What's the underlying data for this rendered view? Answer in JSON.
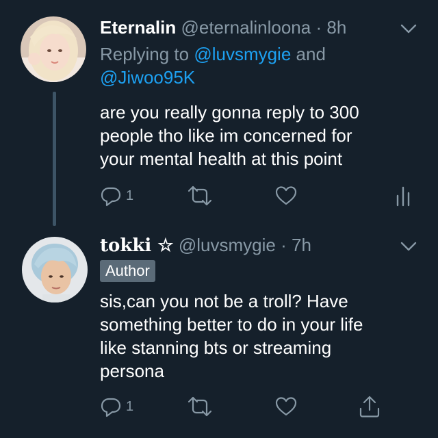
{
  "tweets": [
    {
      "display_name": "Eternalin",
      "handle": "@eternalinloona",
      "separator": "·",
      "time": "8h",
      "replying_to_prefix": "Replying to ",
      "mention_1": "@luvsmygie",
      "mention_joiner": " and",
      "mention_2": "@Jiwoo95K",
      "body_lines": [
        "are you really gonna reply to 300",
        "people tho like im concerned for",
        "your mental health at this point"
      ],
      "reply_count": "1",
      "avatar_icon": "blonde-girl-avatar"
    },
    {
      "display_name": "tokki ☆",
      "handle": "@luvsmygie",
      "separator": "·",
      "time": "7h",
      "badge": "Author",
      "body_lines": [
        "sis,can you not be a troll? Have",
        "something better to do in your life",
        "like stanning bts or streaming",
        "persona"
      ],
      "reply_count": "1",
      "avatar_icon": "blue-haired-boy-avatar"
    }
  ],
  "colors": {
    "background": "#15202b",
    "secondary_text": "#8899a6",
    "link": "#1da1f2",
    "thread_line": "#3d5466",
    "badge": "#5b6b78"
  }
}
